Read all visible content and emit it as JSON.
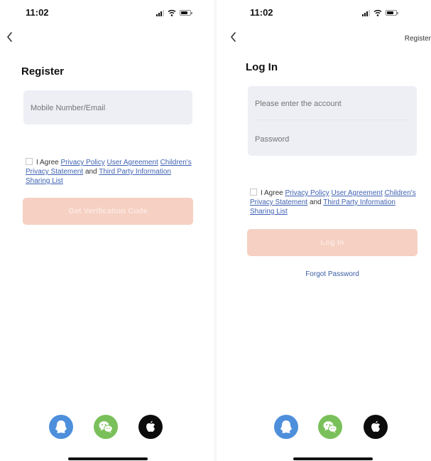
{
  "register_screen": {
    "status_time": "11:02",
    "title": "Register",
    "account_placeholder": "Mobile Number/Email",
    "agreement": {
      "prefix": "I Agree",
      "privacy_policy": "Privacy Policy",
      "user_agreement": "User Agreement",
      "childrens_privacy": "Children's Privacy Statement",
      "and": "and",
      "third_party": "Third Party Information Sharing List"
    },
    "primary_button": "Get Verification Code"
  },
  "login_screen": {
    "status_time": "11:02",
    "register_link": "Register",
    "title": "Log In",
    "account_placeholder": "Please enter the account",
    "password_placeholder": "Password",
    "agreement": {
      "prefix": "I Agree",
      "privacy_policy": "Privacy Policy",
      "user_agreement": "User Agreement",
      "childrens_privacy": "Children's Privacy Statement",
      "and": "and",
      "third_party": "Third Party Information Sharing List"
    },
    "primary_button": "Log In",
    "forgot_password": "Forgot Password"
  },
  "social_login": [
    {
      "icon": "qq-icon",
      "color": "#4d8fdb"
    },
    {
      "icon": "wechat-icon",
      "color": "#7ac05a"
    },
    {
      "icon": "apple-icon",
      "color": "#0c0c0c"
    }
  ],
  "colors": {
    "link": "#3f62b3",
    "button_disabled": "#f6d0c2",
    "input_bg": "#eeeff5"
  }
}
